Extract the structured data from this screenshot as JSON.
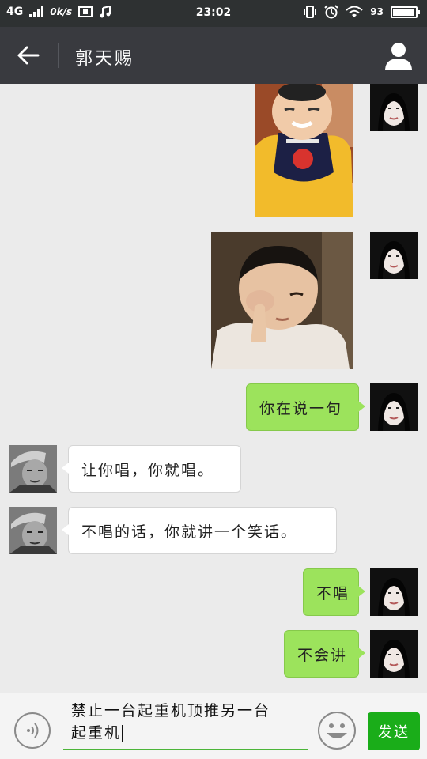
{
  "status_bar": {
    "network": "4G",
    "speed": "0k/s",
    "time": "23:02",
    "battery": "93"
  },
  "header": {
    "title": "郭天赐"
  },
  "messages": [
    {
      "side": "out",
      "kind": "image",
      "content": "baby-laughing-photo"
    },
    {
      "side": "out",
      "kind": "image",
      "content": "toddler-rubbing-eye-photo"
    },
    {
      "side": "out",
      "kind": "text",
      "text": "你在说一句"
    },
    {
      "side": "in",
      "kind": "text",
      "text": "让你唱，你就唱。"
    },
    {
      "side": "in",
      "kind": "text",
      "text": "不唱的话，你就讲一个笑话。"
    },
    {
      "side": "out",
      "kind": "text",
      "text": "不唱"
    },
    {
      "side": "out",
      "kind": "text",
      "text": "不会讲"
    }
  ],
  "composer": {
    "line1": "禁止一台起重机顶推另一台",
    "line2": "起重机",
    "send_label": "发送"
  },
  "colors": {
    "header": "#393a3f",
    "status": "#2e3132",
    "outgoing_bubble": "#9ce35c",
    "send_button": "#1aad19"
  }
}
